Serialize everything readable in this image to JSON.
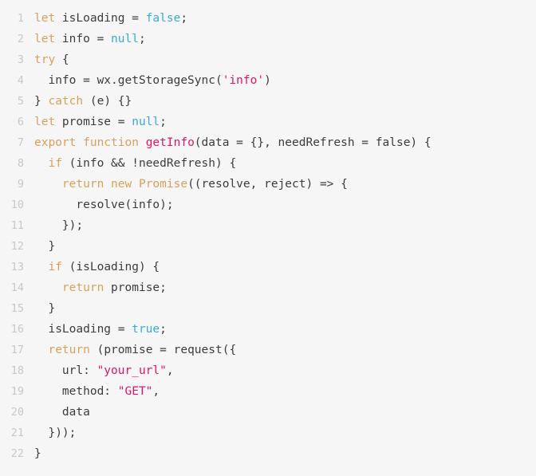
{
  "editor": {
    "language": "javascript",
    "background_color": "#f6f6f6",
    "text_color": "#3c3c3c",
    "gutter_color": "#c8c8c8",
    "palette": {
      "keyword": "#d9a05b",
      "literal": "#36acd7",
      "string": "#e3116c",
      "function": "#e3116c",
      "plain": "#3c3c3c"
    },
    "total_lines": 22,
    "lines": [
      {
        "number": "1",
        "tokens": [
          {
            "t": "let",
            "c": "kw"
          },
          {
            "t": " isLoading = ",
            "c": "plain"
          },
          {
            "t": "false",
            "c": "literal"
          },
          {
            "t": ";",
            "c": "plain"
          }
        ]
      },
      {
        "number": "2",
        "tokens": [
          {
            "t": "let",
            "c": "kw"
          },
          {
            "t": " info = ",
            "c": "plain"
          },
          {
            "t": "null",
            "c": "literal"
          },
          {
            "t": ";",
            "c": "plain"
          }
        ]
      },
      {
        "number": "3",
        "tokens": [
          {
            "t": "try",
            "c": "kw"
          },
          {
            "t": " {",
            "c": "plain"
          }
        ]
      },
      {
        "number": "4",
        "tokens": [
          {
            "t": "  info = wx.getStorageSync(",
            "c": "plain"
          },
          {
            "t": "'info'",
            "c": "str"
          },
          {
            "t": ")",
            "c": "plain"
          }
        ]
      },
      {
        "number": "5",
        "tokens": [
          {
            "t": "} ",
            "c": "plain"
          },
          {
            "t": "catch",
            "c": "kw"
          },
          {
            "t": " (e) {}",
            "c": "plain"
          }
        ]
      },
      {
        "number": "6",
        "tokens": [
          {
            "t": "let",
            "c": "kw"
          },
          {
            "t": " promise = ",
            "c": "plain"
          },
          {
            "t": "null",
            "c": "literal"
          },
          {
            "t": ";",
            "c": "plain"
          }
        ]
      },
      {
        "number": "7",
        "tokens": [
          {
            "t": "export function",
            "c": "kw"
          },
          {
            "t": " ",
            "c": "plain"
          },
          {
            "t": "getInfo",
            "c": "fn"
          },
          {
            "t": "(data = {}, needRefresh = false) {",
            "c": "plain"
          }
        ]
      },
      {
        "number": "8",
        "tokens": [
          {
            "t": "  ",
            "c": "plain"
          },
          {
            "t": "if",
            "c": "kw"
          },
          {
            "t": " (info && !needRefresh) {",
            "c": "plain"
          }
        ]
      },
      {
        "number": "9",
        "tokens": [
          {
            "t": "    ",
            "c": "plain"
          },
          {
            "t": "return new",
            "c": "kw"
          },
          {
            "t": " ",
            "c": "plain"
          },
          {
            "t": "Promise",
            "c": "kw"
          },
          {
            "t": "((resolve, reject) => {",
            "c": "plain"
          }
        ]
      },
      {
        "number": "10",
        "tokens": [
          {
            "t": "      resolve(info);",
            "c": "plain"
          }
        ]
      },
      {
        "number": "11",
        "tokens": [
          {
            "t": "    });",
            "c": "plain"
          }
        ]
      },
      {
        "number": "12",
        "tokens": [
          {
            "t": "  }",
            "c": "plain"
          }
        ]
      },
      {
        "number": "13",
        "tokens": [
          {
            "t": "  ",
            "c": "plain"
          },
          {
            "t": "if",
            "c": "kw"
          },
          {
            "t": " (isLoading) {",
            "c": "plain"
          }
        ]
      },
      {
        "number": "14",
        "tokens": [
          {
            "t": "    ",
            "c": "plain"
          },
          {
            "t": "return",
            "c": "kw"
          },
          {
            "t": " promise;",
            "c": "plain"
          }
        ]
      },
      {
        "number": "15",
        "tokens": [
          {
            "t": "  }",
            "c": "plain"
          }
        ]
      },
      {
        "number": "16",
        "tokens": [
          {
            "t": "  isLoading = ",
            "c": "plain"
          },
          {
            "t": "true",
            "c": "literal"
          },
          {
            "t": ";",
            "c": "plain"
          }
        ]
      },
      {
        "number": "17",
        "tokens": [
          {
            "t": "  ",
            "c": "plain"
          },
          {
            "t": "return",
            "c": "kw"
          },
          {
            "t": " (promise = request({",
            "c": "plain"
          }
        ]
      },
      {
        "number": "18",
        "tokens": [
          {
            "t": "    url: ",
            "c": "plain"
          },
          {
            "t": "\"your_url\"",
            "c": "str"
          },
          {
            "t": ",",
            "c": "plain"
          }
        ]
      },
      {
        "number": "19",
        "tokens": [
          {
            "t": "    method: ",
            "c": "plain"
          },
          {
            "t": "\"GET\"",
            "c": "str"
          },
          {
            "t": ",",
            "c": "plain"
          }
        ]
      },
      {
        "number": "20",
        "tokens": [
          {
            "t": "    data",
            "c": "plain"
          }
        ]
      },
      {
        "number": "21",
        "tokens": [
          {
            "t": "  }));",
            "c": "plain"
          }
        ]
      },
      {
        "number": "22",
        "tokens": [
          {
            "t": "}",
            "c": "plain"
          }
        ]
      }
    ]
  }
}
